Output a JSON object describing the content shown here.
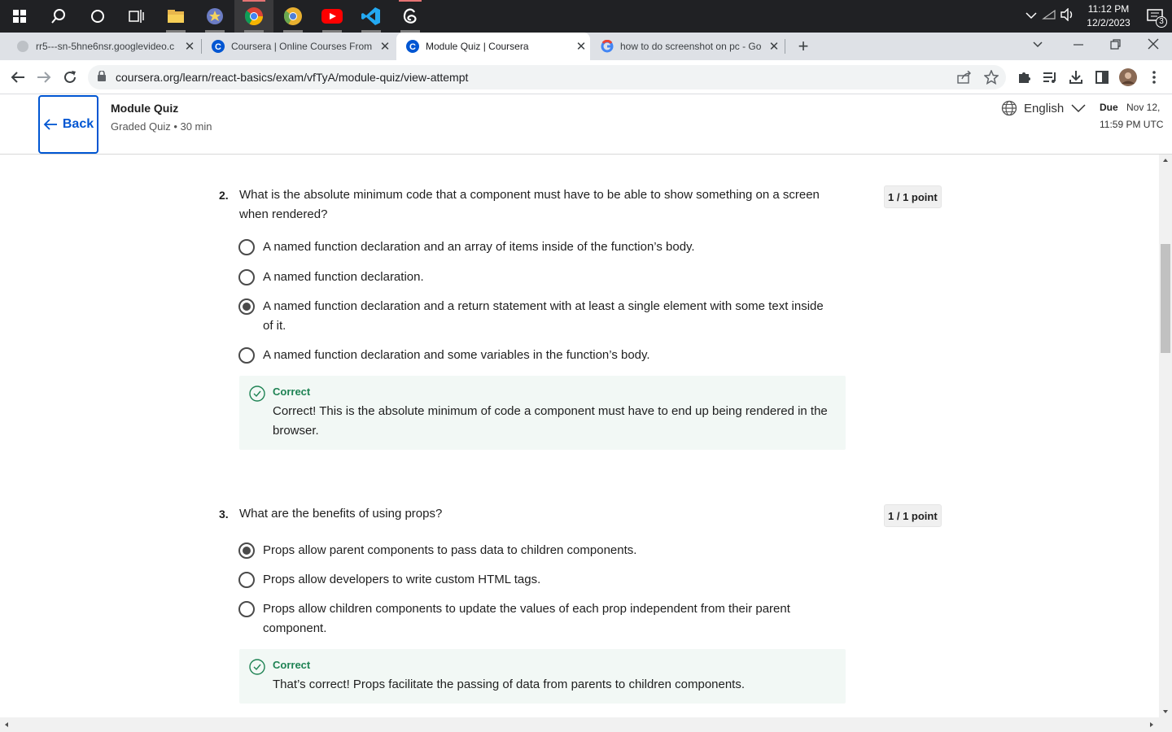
{
  "taskbar": {
    "time": "11:12 PM",
    "date": "12/2/2023",
    "notification_count": "3"
  },
  "tabs": [
    {
      "title": "rr5---sn-5hne6nsr.googlevideo.c",
      "close": "✕"
    },
    {
      "title": "Coursera | Online Courses From",
      "close": "✕"
    },
    {
      "title": "Module Quiz | Coursera",
      "close": "✕"
    },
    {
      "title": "how to do screenshot on pc - Go",
      "close": "✕"
    }
  ],
  "new_tab_label": "+",
  "address": {
    "url": "coursera.org/learn/react-basics/exam/vfTyA/module-quiz/view-attempt"
  },
  "header": {
    "back_label": "Back",
    "title": "Module Quiz",
    "subtitle": "Graded Quiz • 30 min",
    "language": "English",
    "due_label": "Due",
    "due_date": "Nov 12,",
    "due_time": "11:59 PM UTC"
  },
  "questions": [
    {
      "number": "2.",
      "text": "What is the absolute minimum code that a component must have to be able to show something on a screen when rendered?",
      "points": "1 / 1 point",
      "options": [
        {
          "label": "A named function declaration and an array of items inside of the function’s body.",
          "selected": false
        },
        {
          "label": "A named function declaration.",
          "selected": false
        },
        {
          "label": "A named function declaration and a return statement with at least a single element with some text inside of it.",
          "selected": true
        },
        {
          "label": "A named function declaration and some variables in the function’s body.",
          "selected": false
        }
      ],
      "feedback_title": "Correct",
      "feedback_text": "Correct! This is the absolute minimum of code a component must have to end up being rendered in the browser."
    },
    {
      "number": "3.",
      "text": "What are the benefits of using props?",
      "points": "1 / 1 point",
      "options": [
        {
          "label": "Props allow parent components to pass data to children components.",
          "selected": true
        },
        {
          "label": "Props allow developers to write custom HTML tags.",
          "selected": false
        },
        {
          "label": "Props allow children components to update the values of each prop independent from their parent component.",
          "selected": false
        }
      ],
      "feedback_title": "Correct",
      "feedback_text": "That’s correct! Props facilitate the passing of data from parents to children components."
    }
  ],
  "colors": {
    "accent": "#0056d2",
    "correct": "#1f8354",
    "feedback_bg": "#f2f8f5"
  }
}
